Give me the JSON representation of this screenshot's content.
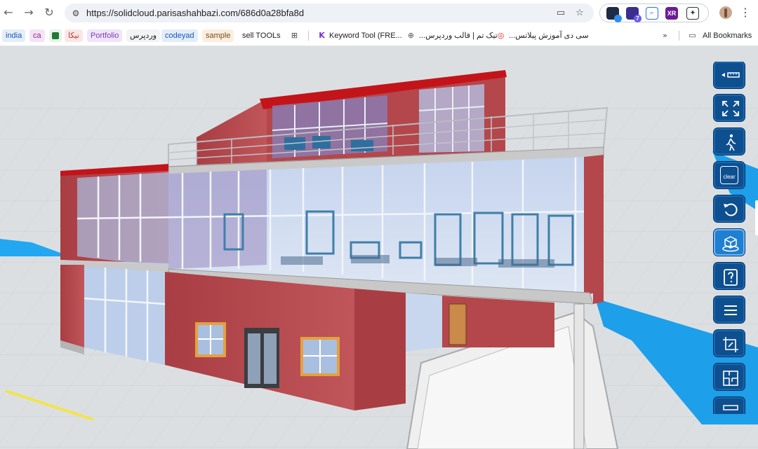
{
  "browser": {
    "url": "https://solidcloud.parisashahbazi.com/686d0a28bfa8d",
    "nav": {
      "back_icon": "arrow-left",
      "forward_icon": "arrow-right",
      "reload_icon": "reload"
    },
    "extensions": [
      {
        "name": "ext-cube-icon",
        "badge": ""
      },
      {
        "name": "ext-hexagon-icon",
        "badge": "7"
      },
      {
        "name": "ext-vr-icon",
        "badge": ""
      },
      {
        "name": "ext-xr-icon",
        "text": "XR"
      },
      {
        "name": "ext-puzzle-icon",
        "badge": ""
      }
    ]
  },
  "bookmarks": {
    "items": [
      {
        "label": "india",
        "bg": "#e3edfb",
        "color": "#1a56b8"
      },
      {
        "label": "ca",
        "bg": "#f4e2f5",
        "color": "#8b2a8f"
      },
      {
        "label": "",
        "bg": "#e8f3e9",
        "color": "#1e7a34"
      },
      {
        "label": "نیکا",
        "bg": "#fbe6e6",
        "color": "#c0392b"
      },
      {
        "label": "Portfolio",
        "bg": "#f0e4fa",
        "color": "#7b3fb3"
      },
      {
        "label": "وردپرس",
        "bg": "#f1f3f4",
        "color": "#202124"
      },
      {
        "label": "codeyad",
        "bg": "#e2edfb",
        "color": "#1a56b8"
      },
      {
        "label": "sample",
        "bg": "#fbeee0",
        "color": "#7a4a1a"
      }
    ],
    "plain": {
      "sell_tools": "sell TOOLs",
      "keyword_tool": "Keyword Tool (FRE...",
      "theme": "تیک تم | قالب وردپرس...",
      "course": "سی دی آموزش پیلاتس...",
      "all_bookmarks": "All Bookmarks"
    }
  },
  "viewer": {
    "toolbar": [
      {
        "name": "measure-icon",
        "label": ""
      },
      {
        "name": "fullscreen-icon",
        "label": ""
      },
      {
        "name": "walk-icon",
        "label": ""
      },
      {
        "name": "clear-icon",
        "label": "clear"
      },
      {
        "name": "reset-icon",
        "label": ""
      },
      {
        "name": "3d-view-icon",
        "label": ""
      },
      {
        "name": "help-icon",
        "label": ""
      },
      {
        "name": "menu-icon",
        "label": ""
      },
      {
        "name": "section-box-icon",
        "label": ""
      },
      {
        "name": "floor-plan-icon",
        "label": ""
      },
      {
        "name": "level-icon",
        "label": ""
      }
    ],
    "colors": {
      "toolbar_bg": "#0d4f8f",
      "toolbar_active": "#1f7fd0",
      "wall": "#b5484c",
      "glass": "#c8d6ec",
      "roof_edge": "#c3141a"
    }
  }
}
